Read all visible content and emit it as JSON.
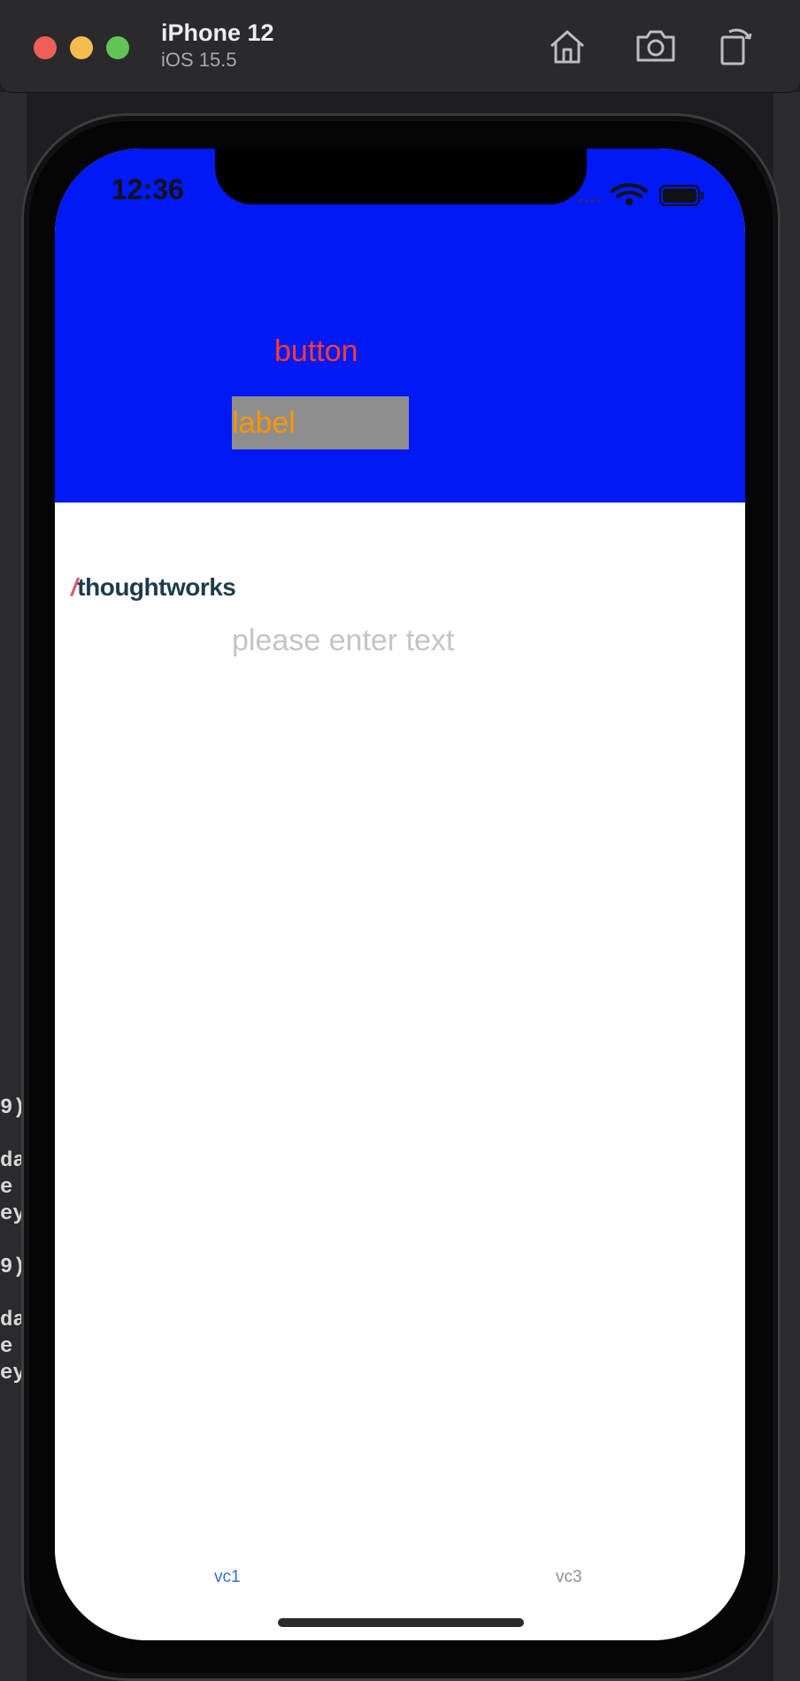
{
  "window": {
    "device_name": "iPhone 12",
    "os_version": "iOS 15.5",
    "toolbar_icons": [
      "home-icon",
      "screenshot-icon",
      "rotate-icon"
    ]
  },
  "status_bar": {
    "time": "12:36"
  },
  "app": {
    "button_label": "button",
    "label_text": "label",
    "logo_slash": "/",
    "logo_text": "thoughtworks",
    "text_field_placeholder": "please enter text",
    "text_field_value": ""
  },
  "tab_bar": {
    "tabs": [
      {
        "label": "vc1",
        "selected": true
      },
      {
        "label": "vc3",
        "selected": false
      }
    ]
  },
  "background_code_fragments": [
    "9)",
    "da",
    "e",
    "ey",
    "9)",
    "da",
    "e",
    "ey"
  ],
  "colors": {
    "header_blue": "#0019f5",
    "button_text": "#ff3b30",
    "label_bg": "#8e8e8e",
    "label_text": "#ff9500",
    "tab_active": "#2f6fd8",
    "tab_inactive": "#8e8e93"
  }
}
